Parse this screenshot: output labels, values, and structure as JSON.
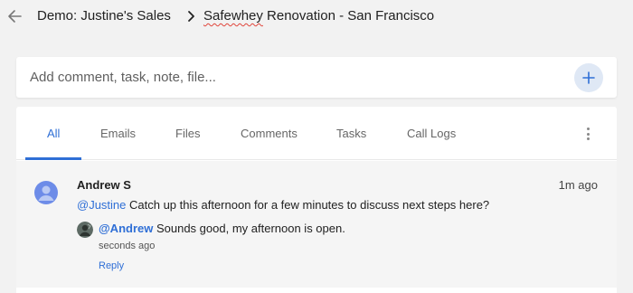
{
  "header": {
    "back_icon": "arrow-left-icon",
    "breadcrumb_root": "Demo: Justine's Sales",
    "separator_icon": "chevron-right-icon",
    "current_page": "Safewhey Renovation - San Francisco",
    "current_page_first_word": "Safewhey",
    "current_page_rest": " Renovation - San Francisco"
  },
  "composer": {
    "placeholder": "Add comment, task, note, file...",
    "add_icon": "plus-icon"
  },
  "tabs": [
    {
      "label": "All",
      "active": true
    },
    {
      "label": "Emails",
      "active": false
    },
    {
      "label": "Files",
      "active": false
    },
    {
      "label": "Comments",
      "active": false
    },
    {
      "label": "Tasks",
      "active": false
    },
    {
      "label": "Call Logs",
      "active": false
    }
  ],
  "more_icon": "more-vertical-icon",
  "colors": {
    "accent": "#2f6fd6",
    "avatar": "#6d8ce8",
    "page_bg": "#f2f2f2"
  },
  "activity": {
    "author": "Andrew S",
    "time": "1m ago",
    "mention": "@Justine",
    "message": " Catch up this afternoon for a few minutes to discuss next steps here?",
    "reply": {
      "mention": "@Andrew",
      "text": " Sounds good, my afternoon is open.",
      "time": "seconds ago",
      "action_label": "Reply"
    }
  }
}
